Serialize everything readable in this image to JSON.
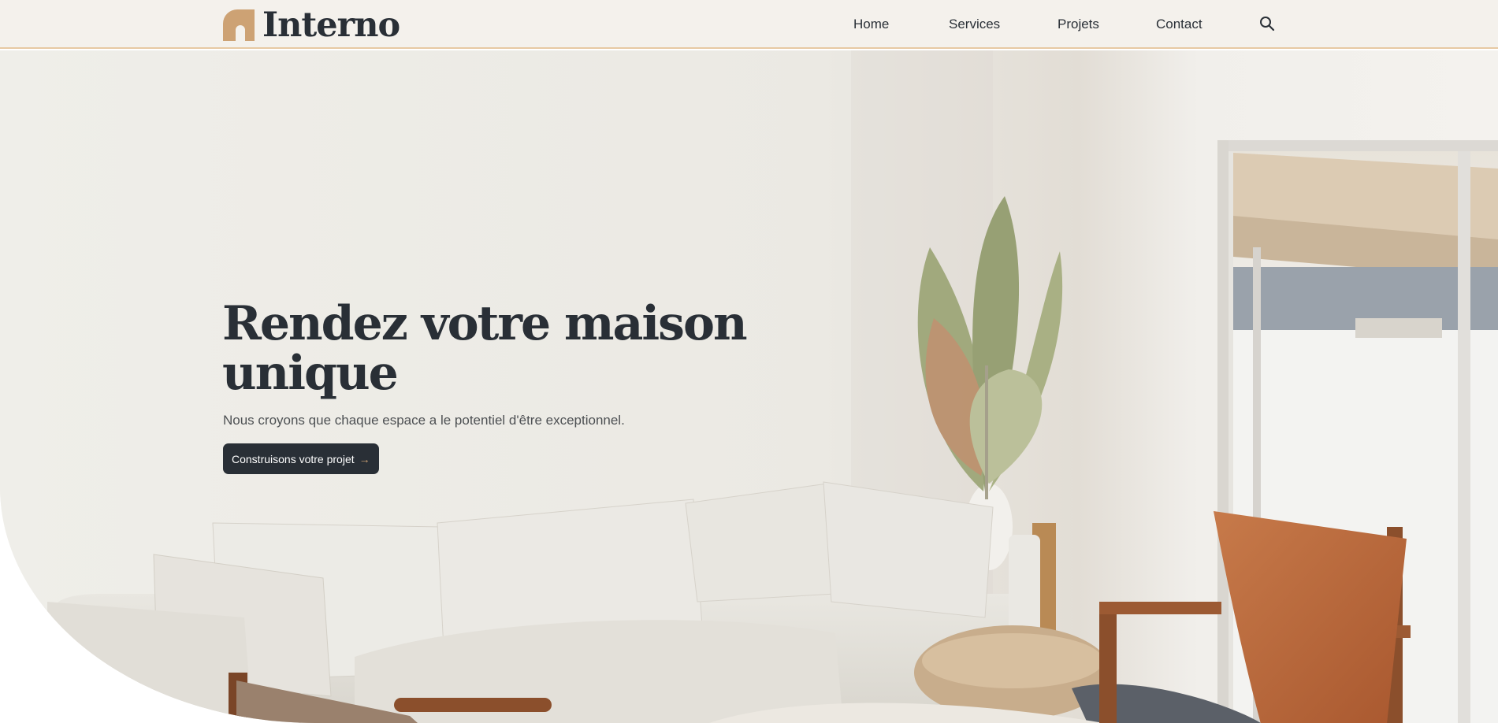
{
  "brand": {
    "name": "Interno",
    "accent": "#cda274",
    "dark": "#292f36"
  },
  "nav": {
    "items": [
      {
        "label": "Home"
      },
      {
        "label": "Services"
      },
      {
        "label": "Projets"
      },
      {
        "label": "Contact"
      }
    ],
    "search_icon": "search-icon"
  },
  "hero": {
    "title": "Rendez votre maison unique",
    "subtitle": "Nous croyons que chaque espace a le potentiel d'être exceptionnel.",
    "cta_label": "Construisons votre projet",
    "cta_icon": "arrow-right-icon",
    "image": "living-room-photo"
  }
}
